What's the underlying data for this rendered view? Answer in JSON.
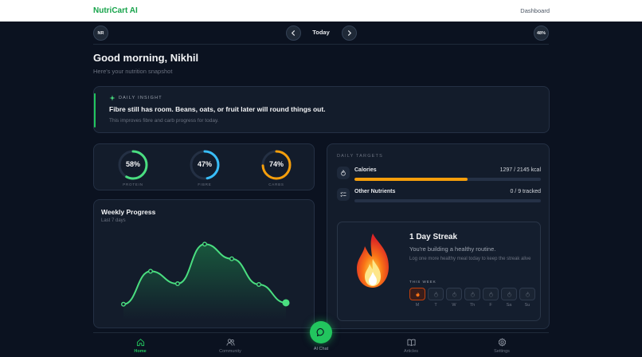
{
  "app": {
    "brand": "NutriCart AI",
    "dashboard_link": "Dashboard"
  },
  "date_nav": {
    "user_initials": "NR",
    "label": "Today",
    "completion_badge": "48%"
  },
  "greeting": {
    "title": "Good morning, Nikhil",
    "subtitle": "Here's your nutrition snapshot"
  },
  "insight": {
    "tag": "DAILY INSIGHT",
    "headline": "Fibre still has room. Beans, oats, or fruit later will round things out.",
    "note": "This improves fibre and carb progress for today."
  },
  "macros": [
    {
      "label": "PROTEIN",
      "value": "58%",
      "percent": 58,
      "color": "#4ade80"
    },
    {
      "label": "FIBRE",
      "value": "47%",
      "percent": 47,
      "color": "#38bdf8"
    },
    {
      "label": "CARBS",
      "value": "74%",
      "percent": 74,
      "color": "#f59e0b"
    }
  ],
  "weekly": {
    "title": "Weekly Progress",
    "subtitle": "Last 7 days",
    "line_color": "#4ade80",
    "values": [
      10,
      55,
      38,
      92,
      72,
      37,
      12
    ]
  },
  "targets": {
    "tag": "DAILY TARGETS",
    "rows": [
      {
        "name": "Calories",
        "value": "1297 / 2145 kcal",
        "progress": 0.605,
        "color": "#f59e0b",
        "icon": "flame-icon"
      },
      {
        "name": "Other Nutrients",
        "value": "0 / 9 tracked",
        "progress": 0,
        "color": "#22c55e",
        "icon": "list-icon"
      }
    ]
  },
  "streak": {
    "title": "1 Day Streak",
    "subtitle": "You're building a healthy routine.",
    "note": "Log one more healthy meal today to keep the streak alive",
    "week_label": "THIS WEEK",
    "days": [
      {
        "label": "M",
        "active": true
      },
      {
        "label": "T",
        "active": false
      },
      {
        "label": "W",
        "active": false
      },
      {
        "label": "Th",
        "active": false
      },
      {
        "label": "F",
        "active": false
      },
      {
        "label": "Sa",
        "active": false
      },
      {
        "label": "Su",
        "active": false
      }
    ]
  },
  "bottom_nav": {
    "home": "Home",
    "community": "Community",
    "chat": "AI Chat",
    "articles": "Articles",
    "settings": "Settings"
  }
}
